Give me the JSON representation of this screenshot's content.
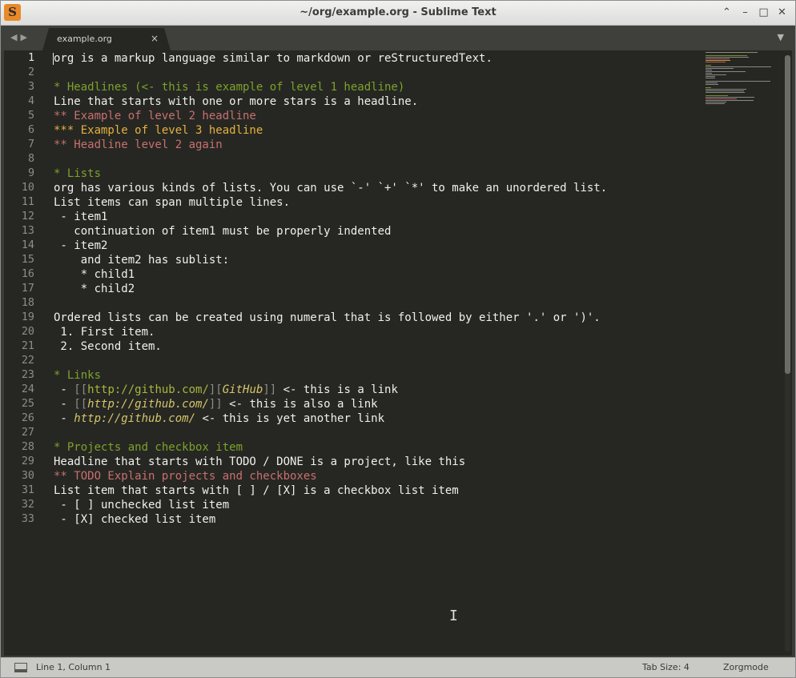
{
  "window": {
    "title": "~/org/example.org - Sublime Text"
  },
  "tabs": [
    {
      "label": "example.org",
      "close": "×"
    }
  ],
  "editor": {
    "current_line": 1,
    "lines": [
      {
        "n": "1",
        "segments": [
          {
            "t": "org is a markup language similar to markdown or reStructuredText.",
            "c": ""
          }
        ]
      },
      {
        "n": "2",
        "segments": []
      },
      {
        "n": "3",
        "segments": [
          {
            "t": "* Headlines (<- this is example of level 1 headline)",
            "c": "c-h1"
          }
        ]
      },
      {
        "n": "4",
        "segments": [
          {
            "t": "Line that starts with one or more stars is a headline.",
            "c": ""
          }
        ]
      },
      {
        "n": "5",
        "segments": [
          {
            "t": "** Example of level 2 headline",
            "c": "c-h2"
          }
        ]
      },
      {
        "n": "6",
        "segments": [
          {
            "t": "*** Example of level 3 headline",
            "c": "c-h3"
          }
        ]
      },
      {
        "n": "7",
        "segments": [
          {
            "t": "** Headline level 2 again",
            "c": "c-h2"
          }
        ]
      },
      {
        "n": "8",
        "segments": []
      },
      {
        "n": "9",
        "segments": [
          {
            "t": "* Lists",
            "c": "c-h1"
          }
        ]
      },
      {
        "n": "10",
        "segments": [
          {
            "t": "org has various kinds of lists. You can use `-' `+' `*' to make an unordered list.",
            "c": ""
          }
        ]
      },
      {
        "n": "11",
        "segments": [
          {
            "t": "List items can span multiple lines.",
            "c": ""
          }
        ]
      },
      {
        "n": "12",
        "segments": [
          {
            "t": " - item1",
            "c": ""
          }
        ]
      },
      {
        "n": "13",
        "segments": [
          {
            "t": "   continuation of item1 must be properly indented",
            "c": ""
          }
        ]
      },
      {
        "n": "14",
        "segments": [
          {
            "t": " - item2",
            "c": ""
          }
        ]
      },
      {
        "n": "15",
        "segments": [
          {
            "t": "    and item2 has sublist:",
            "c": ""
          }
        ]
      },
      {
        "n": "16",
        "segments": [
          {
            "t": "    * child1",
            "c": ""
          }
        ]
      },
      {
        "n": "17",
        "segments": [
          {
            "t": "    * child2",
            "c": ""
          }
        ]
      },
      {
        "n": "18",
        "segments": []
      },
      {
        "n": "19",
        "segments": [
          {
            "t": "Ordered lists can be created using numeral that is followed by either '.' or ')'.",
            "c": ""
          }
        ]
      },
      {
        "n": "20",
        "segments": [
          {
            "t": " 1. First item.",
            "c": ""
          }
        ]
      },
      {
        "n": "21",
        "segments": [
          {
            "t": " 2. Second item.",
            "c": ""
          }
        ]
      },
      {
        "n": "22",
        "segments": []
      },
      {
        "n": "23",
        "segments": [
          {
            "t": "* Links",
            "c": "c-h1"
          }
        ]
      },
      {
        "n": "24",
        "segments": [
          {
            "t": " - ",
            "c": ""
          },
          {
            "t": "[[",
            "c": "c-bracket"
          },
          {
            "t": "http://github.com/",
            "c": "c-link"
          },
          {
            "t": "][",
            "c": "c-bracket"
          },
          {
            "t": "GitHub",
            "c": "c-italic"
          },
          {
            "t": "]]",
            "c": "c-bracket"
          },
          {
            "t": " <- this is a link",
            "c": ""
          }
        ]
      },
      {
        "n": "25",
        "segments": [
          {
            "t": " - ",
            "c": ""
          },
          {
            "t": "[[",
            "c": "c-bracket"
          },
          {
            "t": "http://github.com/",
            "c": "c-italic"
          },
          {
            "t": "]]",
            "c": "c-bracket"
          },
          {
            "t": " <- this is also a link",
            "c": ""
          }
        ]
      },
      {
        "n": "26",
        "segments": [
          {
            "t": " - ",
            "c": ""
          },
          {
            "t": "http://github.com/",
            "c": "c-italic"
          },
          {
            "t": " <- this is yet another link",
            "c": ""
          }
        ]
      },
      {
        "n": "27",
        "segments": []
      },
      {
        "n": "28",
        "segments": [
          {
            "t": "* Projects and checkbox item",
            "c": "c-h1"
          }
        ]
      },
      {
        "n": "29",
        "segments": [
          {
            "t": "Headline that starts with TODO / DONE is a project, like this",
            "c": ""
          }
        ]
      },
      {
        "n": "30",
        "segments": [
          {
            "t": "** TODO Explain projects and checkboxes",
            "c": "c-h2"
          }
        ]
      },
      {
        "n": "31",
        "segments": [
          {
            "t": "List item that starts with [ ] / [X] is a checkbox list item",
            "c": ""
          }
        ]
      },
      {
        "n": "32",
        "segments": [
          {
            "t": " - [ ] unchecked list item",
            "c": ""
          }
        ]
      },
      {
        "n": "33",
        "segments": [
          {
            "t": " - [X] checked list item",
            "c": ""
          }
        ]
      }
    ]
  },
  "statusbar": {
    "position": "Line 1, Column 1",
    "tab_size": "Tab Size: 4",
    "syntax": "Zorgmode"
  },
  "colors": {
    "editor_bg": "#262723",
    "headline1": "#7da22a",
    "headline2": "#c8706e",
    "headline3": "#e6b13d",
    "text": "#f0f0ea"
  }
}
